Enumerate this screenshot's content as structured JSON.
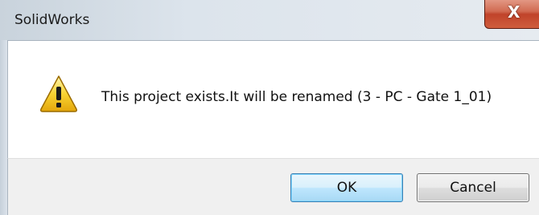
{
  "dialog": {
    "title": "SolidWorks",
    "close_glyph": "X",
    "icon": "warning-icon",
    "message": "This project exists.It will be renamed (3 - PC - Gate 1_01)"
  },
  "buttons": {
    "ok_label": "OK",
    "cancel_label": "Cancel"
  },
  "colors": {
    "close_button": "#c0432a",
    "warning_fill": "#f5c518",
    "ok_border": "#3c7fb1"
  }
}
